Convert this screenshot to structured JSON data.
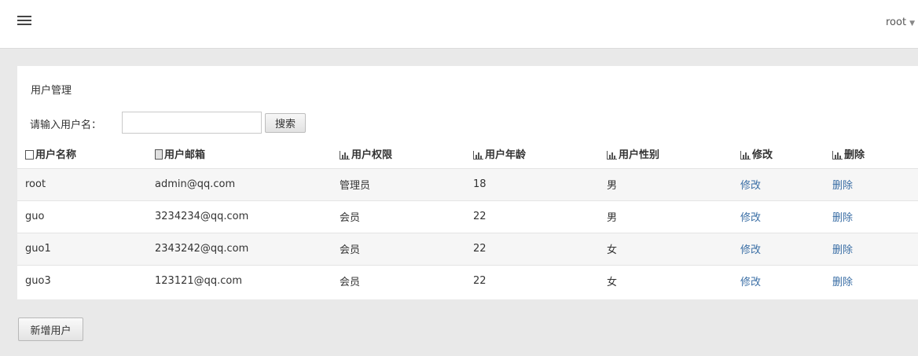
{
  "header": {
    "menu_icon": "hamburger-menu-icon",
    "user_name": "root"
  },
  "panel": {
    "title": "用户管理",
    "search": {
      "label": "请输入用户名：",
      "value": "",
      "placeholder": "",
      "button_label": "搜索"
    },
    "table": {
      "columns": [
        "用户名称",
        "用户邮箱",
        "用户权限",
        "用户年龄",
        "用户性别",
        "修改",
        "删除"
      ],
      "column_icons": [
        "checkbox-icon",
        "document-icon",
        "bar-chart-icon",
        "bar-chart-icon",
        "bar-chart-icon",
        "bar-chart-icon",
        "bar-chart-icon"
      ],
      "rows": [
        {
          "name": "root",
          "email": "admin@qq.com",
          "role": "管理员",
          "age": "18",
          "gender": "男",
          "edit": "修改",
          "delete": "删除"
        },
        {
          "name": "guo",
          "email": "3234234@qq.com",
          "role": "会员",
          "age": "22",
          "gender": "男",
          "edit": "修改",
          "delete": "删除"
        },
        {
          "name": "guo1",
          "email": "2343242@qq.com",
          "role": "会员",
          "age": "22",
          "gender": "女",
          "edit": "修改",
          "delete": "删除"
        },
        {
          "name": "guo3",
          "email": "123121@qq.com",
          "role": "会员",
          "age": "22",
          "gender": "女",
          "edit": "修改",
          "delete": "删除"
        }
      ]
    }
  },
  "actions": {
    "add_user_label": "新增用户"
  },
  "colors": {
    "link": "#3a6ea5",
    "background": "#e9e9e9",
    "panel": "#ffffff"
  }
}
